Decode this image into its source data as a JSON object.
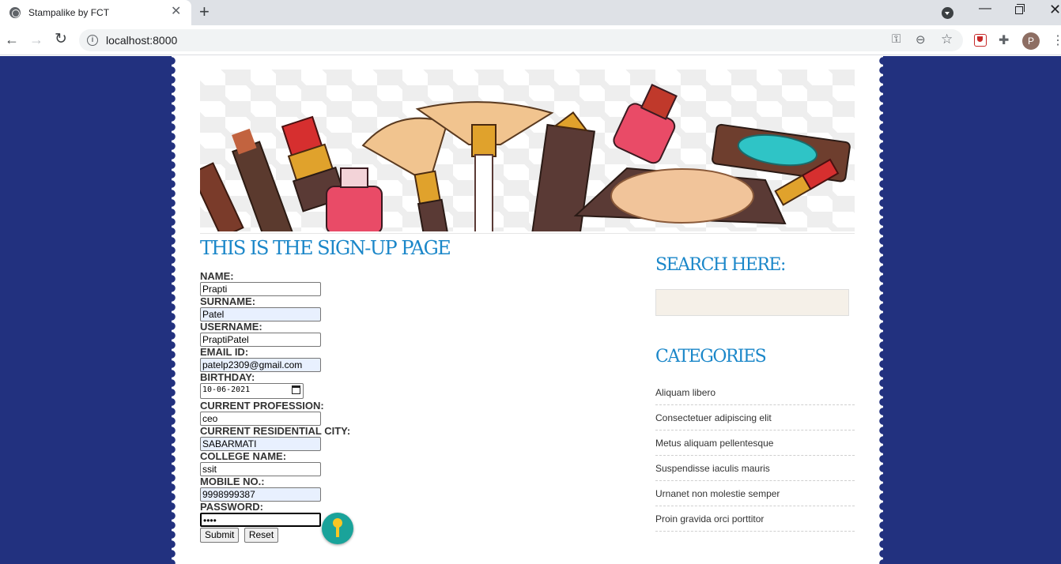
{
  "browser": {
    "tab_title": "Stampalike by FCT",
    "url": "localhost:8000",
    "profile_initial": "P"
  },
  "page": {
    "signup_heading": "THIS IS THE SIGN-UP PAGE",
    "form": {
      "name_label": "NAME:",
      "name_value": "Prapti",
      "surname_label": "SURNAME:",
      "surname_value": "Patel",
      "username_label": "USERNAME:",
      "username_value": "PraptiPatel",
      "email_label": "EMAIL ID:",
      "email_value": "patelp2309@gmail.com",
      "birthday_label": "BIRTHDAY:",
      "birthday_value": "10-06-2021",
      "profession_label": "CURRENT PROFESSION:",
      "profession_value": "ceo",
      "city_label": "CURRENT RESIDENTIAL CITY:",
      "city_value": "SABARMATI",
      "college_label": "COLLEGE NAME:",
      "college_value": "ssit",
      "mobile_label": "MOBILE NO.:",
      "mobile_value": "9998999387",
      "password_label": "PASSWORD:",
      "password_value": "••••",
      "submit_label": "Submit",
      "reset_label": "Reset"
    },
    "sidebar": {
      "search_heading": "SEARCH HERE:",
      "categories_heading": "CATEGORIES",
      "categories": [
        "Aliquam libero",
        "Consectetuer adipiscing elit",
        "Metus aliquam pellentesque",
        "Suspendisse iaculis mauris",
        "Urnanet non molestie semper",
        "Proin gravida orci porttitor"
      ]
    }
  },
  "colors": {
    "page_background": "#22317f",
    "heading_blue": "#1b87c9",
    "search_box_fill": "#f5f0e8",
    "password_manager_badge": "#1aa39a"
  },
  "icons": [
    "globe-icon",
    "close-icon",
    "plus-icon",
    "back-arrow-icon",
    "forward-arrow-icon",
    "reload-icon",
    "info-icon",
    "key-icon",
    "zoom-icon",
    "star-icon",
    "pocket-icon",
    "puzzle-icon",
    "calendar-icon"
  ]
}
